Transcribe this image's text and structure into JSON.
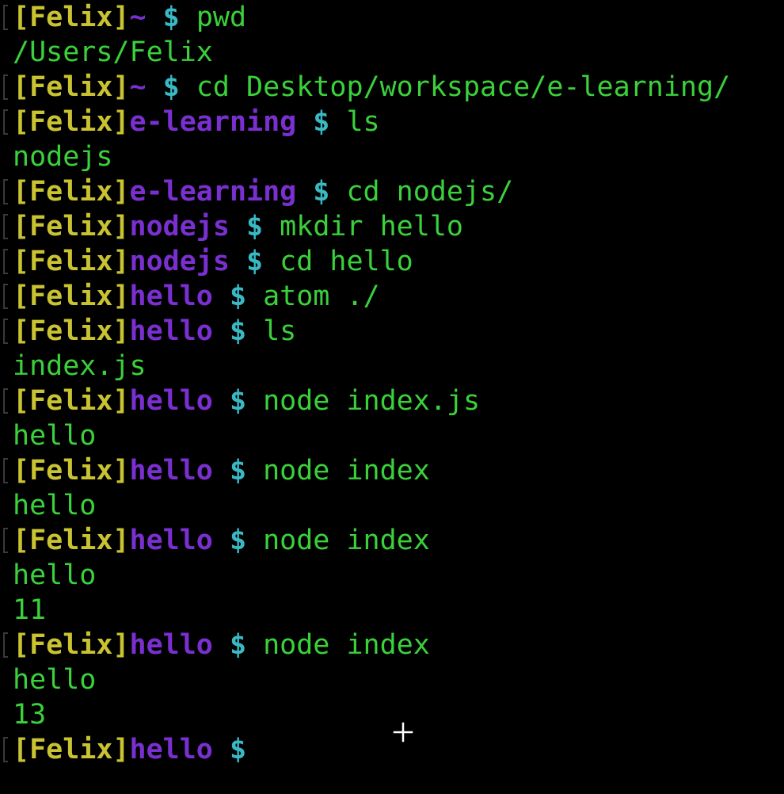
{
  "terminal": {
    "lines": [
      {
        "type": "prompt",
        "user": "[Felix]",
        "dir": "~",
        "dollar": " $ ",
        "cmd": "pwd"
      },
      {
        "type": "output",
        "text": "/Users/Felix"
      },
      {
        "type": "prompt",
        "user": "[Felix]",
        "dir": "~",
        "dollar": " $ ",
        "cmd": "cd Desktop/workspace/e-learning/"
      },
      {
        "type": "prompt",
        "user": "[Felix]",
        "dir": "e-learning",
        "dollar": " $ ",
        "cmd": "ls"
      },
      {
        "type": "output",
        "text": "nodejs"
      },
      {
        "type": "prompt",
        "user": "[Felix]",
        "dir": "e-learning",
        "dollar": " $ ",
        "cmd": "cd nodejs/"
      },
      {
        "type": "prompt",
        "user": "[Felix]",
        "dir": "nodejs",
        "dollar": " $ ",
        "cmd": "mkdir hello"
      },
      {
        "type": "prompt",
        "user": "[Felix]",
        "dir": "nodejs",
        "dollar": " $ ",
        "cmd": "cd hello"
      },
      {
        "type": "prompt",
        "user": "[Felix]",
        "dir": "hello",
        "dollar": " $ ",
        "cmd": "atom ./"
      },
      {
        "type": "prompt",
        "user": "[Felix]",
        "dir": "hello",
        "dollar": " $ ",
        "cmd": "ls"
      },
      {
        "type": "output",
        "text": "index.js"
      },
      {
        "type": "prompt",
        "user": "[Felix]",
        "dir": "hello",
        "dollar": " $ ",
        "cmd": "node index.js"
      },
      {
        "type": "output",
        "text": "hello"
      },
      {
        "type": "prompt",
        "user": "[Felix]",
        "dir": "hello",
        "dollar": " $ ",
        "cmd": "node index"
      },
      {
        "type": "output",
        "text": "hello"
      },
      {
        "type": "prompt",
        "user": "[Felix]",
        "dir": "hello",
        "dollar": " $ ",
        "cmd": "node index"
      },
      {
        "type": "output",
        "text": "hello"
      },
      {
        "type": "output",
        "text": "11"
      },
      {
        "type": "prompt",
        "user": "[Felix]",
        "dir": "hello",
        "dollar": " $ ",
        "cmd": "node index"
      },
      {
        "type": "output",
        "text": "hello"
      },
      {
        "type": "output",
        "text": "13"
      },
      {
        "type": "prompt",
        "user": "[Felix]",
        "dir": "hello",
        "dollar": " $ ",
        "cmd": ""
      }
    ]
  },
  "colors": {
    "background": "#000000",
    "user": "#c9c231",
    "dir": "#7a2fd0",
    "dollar": "#39b9c4",
    "command": "#3ad13a",
    "output": "#3ad13a"
  },
  "cursor": {
    "icon": "crosshair-cursor-icon"
  }
}
